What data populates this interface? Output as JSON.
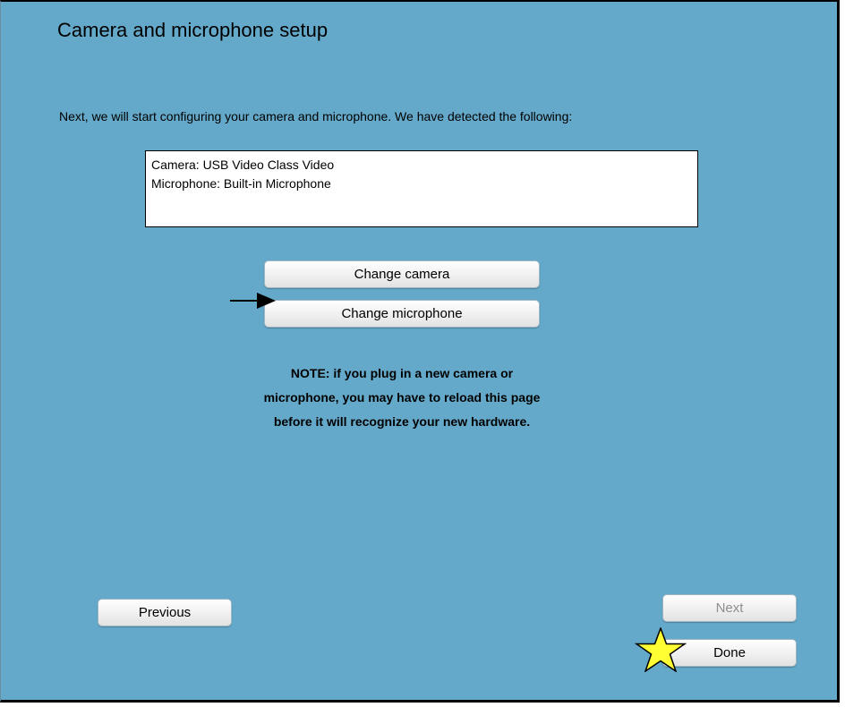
{
  "page": {
    "title": "Camera and microphone setup",
    "intro": "Next, we will start configuring your camera and microphone.  We have detected the following:"
  },
  "devices": {
    "camera": "Camera:  USB Video Class Video",
    "microphone": "Microphone:  Built-in Microphone"
  },
  "buttons": {
    "change_camera": "Change camera",
    "change_microphone": "Change microphone",
    "previous": "Previous",
    "next": "Next",
    "done": "Done"
  },
  "note": {
    "line1": "NOTE:  if you plug in a new camera or",
    "line2": "microphone, you may have to reload this page",
    "line3": "before it will recognize your new hardware."
  },
  "annotations": {
    "arrow_icon": "arrow-right-icon",
    "star_icon": "star-icon",
    "star_color": "#ffff33"
  },
  "colors": {
    "background": "#65a9ca",
    "disabled_text": "#8f8f8f"
  }
}
